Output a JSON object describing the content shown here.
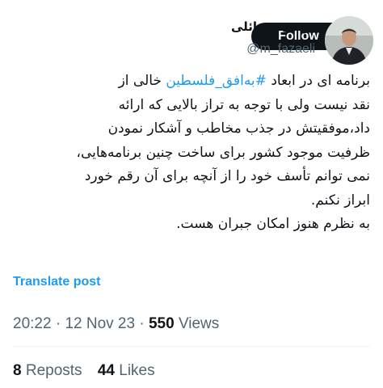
{
  "author": {
    "display_name": "مهدی فضائلی",
    "handle": "@m_fazaeli"
  },
  "follow_button": {
    "label": "Follow"
  },
  "post": {
    "lines": [
      [
        "برنامه ای در ابعاد ",
        "#به‌افق_فلسطین",
        " خالی از"
      ],
      [
        "نقد نیست ولی با توجه به تراز بالایی که ارائه"
      ],
      [
        "داد،موفقیتش در جذب مخاطب و آشکار نمودن"
      ],
      [
        "ظرفیت موجود کشور برای ساخت چنین برنامه‌هایی،"
      ],
      [
        "نمی توانم تأسف خود را از آنچه برای آن رقم خورد"
      ],
      [
        "ابراز نکنم."
      ],
      [
        "به نظرم هنوز امکان جبران هست."
      ]
    ],
    "hashtag": "#به‌افق_فلسطین"
  },
  "translate": {
    "label": "Translate post"
  },
  "meta": {
    "time": "20:22",
    "separator": "·",
    "date": "12 Nov 23",
    "views_count": "550",
    "views_label": "Views"
  },
  "stats": {
    "reposts_count": "8",
    "reposts_label": "Reposts",
    "likes_count": "44",
    "likes_label": "Likes"
  },
  "colors": {
    "link": "#1d9bf0",
    "text": "#0f1419",
    "muted": "#536471",
    "button_bg": "#0f1419"
  }
}
